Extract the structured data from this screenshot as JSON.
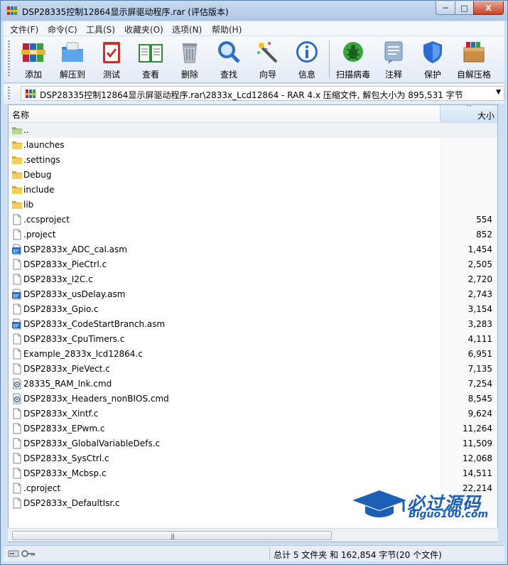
{
  "window": {
    "title": "DSP28335控制12864显示屏驱动程序.rar (评估版本)",
    "minimize": "─",
    "maximize": "□",
    "close": "X"
  },
  "menu": [
    "文件(F)",
    "命令(C)",
    "工具(S)",
    "收藏夹(O)",
    "选项(N)",
    "帮助(H)"
  ],
  "toolbar": [
    {
      "label": "添加",
      "icon": "books-add-icon"
    },
    {
      "label": "解压到",
      "icon": "folder-extract-icon"
    },
    {
      "label": "测试",
      "icon": "clipboard-check-icon"
    },
    {
      "label": "查看",
      "icon": "open-book-icon"
    },
    {
      "label": "删除",
      "icon": "trash-can-icon"
    },
    {
      "label": "查找",
      "icon": "magnifier-icon"
    },
    {
      "label": "向导",
      "icon": "magic-wand-icon"
    },
    {
      "label": "信息",
      "icon": "info-icon"
    },
    {
      "label": "扫描病毒",
      "icon": "virus-scan-icon"
    },
    {
      "label": "注释",
      "icon": "comment-icon"
    },
    {
      "label": "保护",
      "icon": "shield-icon"
    },
    {
      "label": "自解压格",
      "icon": "sfx-box-icon"
    }
  ],
  "address": {
    "text": "DSP28335控制12864显示屏驱动程序.rar\\2833x_Lcd12864 - RAR 4.x 压缩文件, 解包大小为 895,531 字节",
    "dropdown": "▼"
  },
  "columns": {
    "name": "名称",
    "size": "大小",
    "sort_indicator": "^"
  },
  "files": [
    {
      "name": "..",
      "size": "",
      "type": "up"
    },
    {
      "name": ".launches",
      "size": "",
      "type": "folder"
    },
    {
      "name": ".settings",
      "size": "",
      "type": "folder"
    },
    {
      "name": "Debug",
      "size": "",
      "type": "folder"
    },
    {
      "name": "include",
      "size": "",
      "type": "folder"
    },
    {
      "name": "lib",
      "size": "",
      "type": "folder"
    },
    {
      "name": ".ccsproject",
      "size": "554",
      "type": "file"
    },
    {
      "name": ".project",
      "size": "852",
      "type": "file"
    },
    {
      "name": "DSP2833x_ADC_cal.asm",
      "size": "1,454",
      "type": "asm"
    },
    {
      "name": "DSP2833x_PieCtrl.c",
      "size": "2,505",
      "type": "file"
    },
    {
      "name": "DSP2833x_I2C.c",
      "size": "2,720",
      "type": "file"
    },
    {
      "name": "DSP2833x_usDelay.asm",
      "size": "2,743",
      "type": "asm"
    },
    {
      "name": "DSP2833x_Gpio.c",
      "size": "3,154",
      "type": "file"
    },
    {
      "name": "DSP2833x_CodeStartBranch.asm",
      "size": "3,283",
      "type": "asm"
    },
    {
      "name": "DSP2833x_CpuTimers.c",
      "size": "4,111",
      "type": "file"
    },
    {
      "name": "Example_2833x_lcd12864.c",
      "size": "6,951",
      "type": "file"
    },
    {
      "name": "DSP2833x_PieVect.c",
      "size": "7,135",
      "type": "file"
    },
    {
      "name": "28335_RAM_lnk.cmd",
      "size": "7,254",
      "type": "cmd"
    },
    {
      "name": "DSP2833x_Headers_nonBIOS.cmd",
      "size": "8,545",
      "type": "cmd"
    },
    {
      "name": "DSP2833x_Xintf.c",
      "size": "9,624",
      "type": "file"
    },
    {
      "name": "DSP2833x_EPwm.c",
      "size": "11,264",
      "type": "file"
    },
    {
      "name": "DSP2833x_GlobalVariableDefs.c",
      "size": "11,509",
      "type": "file"
    },
    {
      "name": "DSP2833x_SysCtrl.c",
      "size": "12,068",
      "type": "file"
    },
    {
      "name": "DSP2833x_Mcbsp.c",
      "size": "14,511",
      "type": "file"
    },
    {
      "name": ".cproject",
      "size": "22,214",
      "type": "file"
    },
    {
      "name": "DSP2833x_DefaultIsr.c",
      "size": "",
      "type": "file"
    }
  ],
  "status": {
    "text": "总计 5 文件夹 和 162,854 字节(20 个文件)"
  },
  "watermark": {
    "line1": "必过源码",
    "line2": "Biguo100.com"
  }
}
